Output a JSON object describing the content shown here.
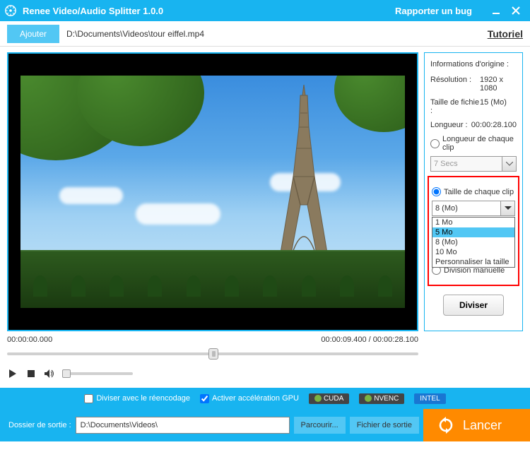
{
  "titlebar": {
    "title": "Renee Video/Audio Splitter 1.0.0",
    "report": "Rapporter un bug"
  },
  "toolbar": {
    "add": "Ajouter",
    "filepath": "D:\\Documents\\Videos\\tour eiffel.mp4",
    "tutorial": "Tutoriel"
  },
  "timeline": {
    "start": "00:00:00.000",
    "position": "00:00:09.400",
    "duration": "00:00:28.100"
  },
  "info": {
    "heading": "Informations d'origine :",
    "res_lbl": "Résolution :",
    "res_val": "1920 x 1080",
    "size_lbl": "Taille de fichie :",
    "size_val": "15 (Mo)",
    "len_lbl": "Longueur :",
    "len_val": "00:00:28.100"
  },
  "split": {
    "by_length": "Longueur de chaque clip",
    "length_value": "7 Secs",
    "by_size": "Taille de chaque clip",
    "size_value": "8 (Mo)",
    "options": {
      "o1": "1 Mo",
      "o2": "5 Mo",
      "o3": "8 (Mo)",
      "o4": "10 Mo",
      "o5": "Personnaliser la taille"
    },
    "manual": "Division manuelle",
    "divide": "Diviser"
  },
  "options": {
    "reencode": "Diviser avec le réencodage",
    "gpu": "Activer accélération GPU",
    "cuda": "CUDA",
    "nvenc": "NVENC",
    "intel": "INTEL"
  },
  "footer": {
    "out_lbl": "Dossier de sortie :",
    "out_path": "D:\\Documents\\Videos\\",
    "browse": "Parcourir...",
    "open_folder": "Fichier de sortie",
    "launch": "Lancer"
  }
}
